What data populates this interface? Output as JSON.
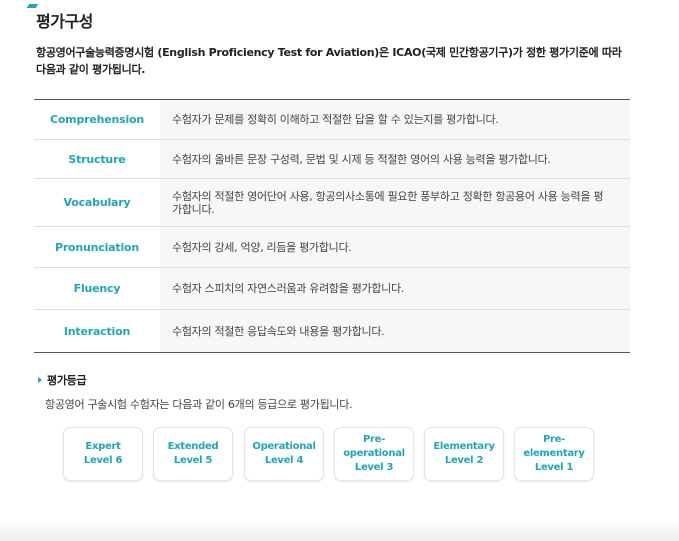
{
  "page": {
    "title": "평가구성",
    "intro": "항공영어구술능력증명시험 (English Proficiency Test for Aviation)은 ICAO(국제 민간항공기구)가 정한 평가기준에 따라 다음과 같이 평가됩니다."
  },
  "criteria": [
    {
      "name": "Comprehension",
      "description": "수험자가 문제를 정확히 이해하고 적절한 답을 할 수 있는지를 평가합니다."
    },
    {
      "name": "Structure",
      "description": "수험자의 올바른 문장 구성력, 문법 및 시제 등 적절한 영어의 사용 능력을 평가합니다."
    },
    {
      "name": "Vocabulary",
      "description": "수험자의 적절한 영어단어 사용, 항공의사소통에 필요한 풍부하고 정확한 항공용어 사용 능력을 평가합니다."
    },
    {
      "name": "Pronunciation",
      "description": "수험자의 강세, 억양, 리듬을 평가합니다."
    },
    {
      "name": "Fluency",
      "description": "수험자 스피치의 자연스러움과 유려함을 평가합니다."
    },
    {
      "name": "Interaction",
      "description": "수험자의 적절한 응답속도와 내용을 평가합니다."
    }
  ],
  "grades": {
    "title": "평가등급",
    "intro": "항공영어 구술시험 수험자는 다음과 같이 6개의 등급으로 평가됩니다.",
    "levels": [
      {
        "name": "Expert",
        "level": "Level 6"
      },
      {
        "name": "Extended",
        "level": "Level 5"
      },
      {
        "name": "Operational",
        "level": "Level 4"
      },
      {
        "name": "Pre-operational",
        "level": "Level 3"
      },
      {
        "name": "Elementary",
        "level": "Level 2"
      },
      {
        "name": "Pre-elementary",
        "level": "Level 1"
      }
    ]
  },
  "colors": {
    "accent": "#1fa7b5",
    "row_bg": "#f7f7f7"
  }
}
